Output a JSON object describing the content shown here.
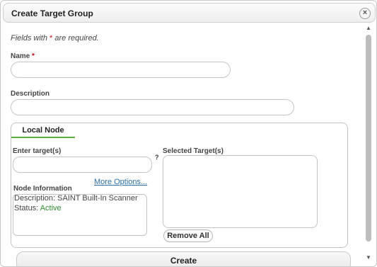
{
  "dialog": {
    "title": "Create Target Group",
    "close_icon": "close-circle-icon"
  },
  "form": {
    "required_note_prefix": "Fields with ",
    "required_star": "*",
    "required_note_suffix": " are required.",
    "name_label": "Name",
    "name_star": "*",
    "name_value": "",
    "description_label": "Description",
    "description_value": ""
  },
  "tabs": {
    "local_node": "Local Node",
    "accent_color": "#5cae3e"
  },
  "targets": {
    "enter_label": "Enter target(s)",
    "enter_value": "",
    "help_mark": "?",
    "more_options": "More Options...",
    "selected_label": "Selected Target(s)",
    "remove_all": "Remove All"
  },
  "node_info": {
    "label": "Node Information",
    "description": "Description: SAINT Built-In Scanner",
    "status_prefix": "Status: ",
    "status_value": "Active",
    "status_color": "#2e8b2e"
  },
  "actions": {
    "create": "Create"
  },
  "scrollbar": {
    "up_icon": "scroll-up-arrow-icon",
    "down_icon": "scroll-down-arrow-icon"
  }
}
